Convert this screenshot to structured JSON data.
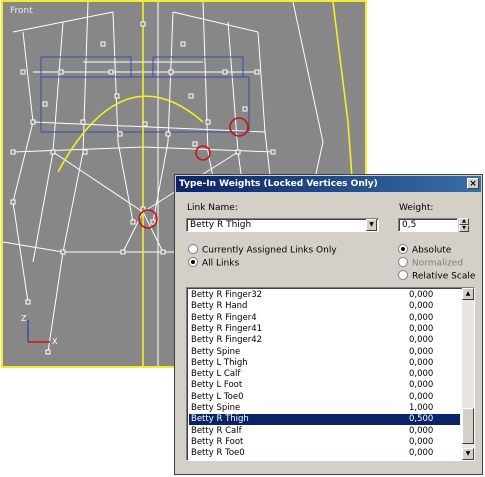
{
  "viewport": {
    "label": "Front"
  },
  "dialog": {
    "title": "Type-In Weights (Locked Vertices Only)",
    "close_glyph": "×",
    "link_name_label": "Link Name:",
    "link_name_value": "Betty R Thigh",
    "weight_label": "Weight:",
    "weight_value": "0,5",
    "options": {
      "currently_assigned": "Currently Assigned Links Only",
      "all_links": "All Links",
      "absolute": "Absolute",
      "normalized": "Normalized",
      "relative_scale": "Relative Scale"
    },
    "rows": [
      {
        "name": "Betty R Finger32",
        "weight": "0,000"
      },
      {
        "name": "Betty R Hand",
        "weight": "0,000"
      },
      {
        "name": "Betty R Finger4",
        "weight": "0,000"
      },
      {
        "name": "Betty R Finger41",
        "weight": "0,000"
      },
      {
        "name": "Betty R Finger42",
        "weight": "0,000"
      },
      {
        "name": "Betty Spine",
        "weight": "0,000"
      },
      {
        "name": "Betty L Thigh",
        "weight": "0,000"
      },
      {
        "name": "Betty L Calf",
        "weight": "0,000"
      },
      {
        "name": "Betty L Foot",
        "weight": "0,000"
      },
      {
        "name": "Betty L Toe0",
        "weight": "0,000"
      },
      {
        "name": "Betty Spine",
        "weight": "1,000"
      },
      {
        "name": "Betty R Thigh",
        "weight": "0,500"
      },
      {
        "name": "Betty R Calf",
        "weight": "0,000"
      },
      {
        "name": "Betty R Foot",
        "weight": "0,000"
      },
      {
        "name": "Betty R Toe0",
        "weight": "0,000"
      }
    ],
    "selected_row": "Betty R Thigh",
    "weight_spinner": 0.5
  },
  "axis_labels": {
    "z": "Z",
    "x": "X"
  },
  "colors": {
    "viewport_bg": "#878787",
    "wire": "#ffffff",
    "bone": "#f2ef2a",
    "mesh_box": "#3a4ea8",
    "marker": "#d01010",
    "selection": "#0a246a"
  }
}
